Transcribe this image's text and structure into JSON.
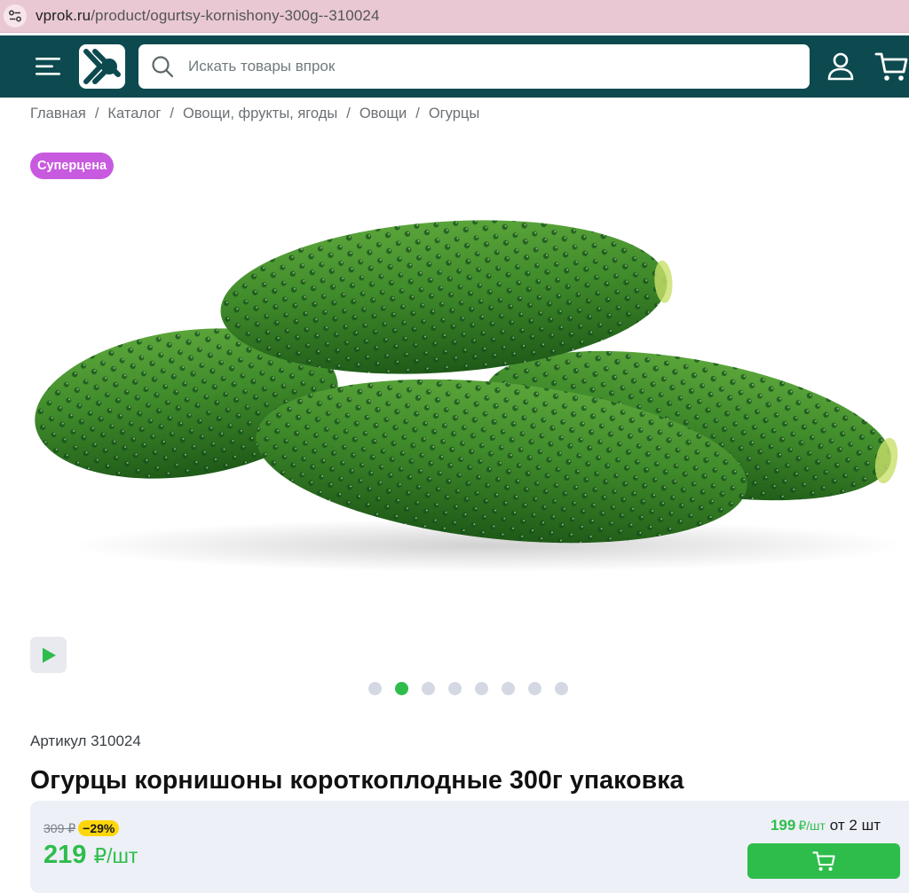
{
  "browser": {
    "url_host": "vprok.ru",
    "url_path": "/product/ogurtsy-kornishony-300g--310024",
    "site_info_icon": "tune-icon"
  },
  "header": {
    "search_placeholder": "Искать товары впрок",
    "icons": {
      "menu": "hamburger-menu-icon",
      "logo": "vprok-logo",
      "search": "search-icon",
      "profile": "user-icon",
      "cart": "cart-icon"
    },
    "colors": {
      "background": "#0d4a4f"
    }
  },
  "breadcrumb": [
    "Главная",
    "Каталог",
    "Овощи, фрукты, ягоды",
    "Овощи",
    "Огурцы"
  ],
  "breadcrumb_separator": "/",
  "badge": {
    "label": "Суперцена",
    "color": "#c85ae0"
  },
  "gallery": {
    "image_subject": "cucumbers",
    "slide_count": 8,
    "active_slide_index": 1,
    "play_icon": "play-icon"
  },
  "product": {
    "sku_label": "Артикул 310024",
    "title": "Огурцы корнишоны короткоплодные 300г упаковка"
  },
  "pricing": {
    "old_price": "309 ₽",
    "discount": "−29%",
    "price_value": "219",
    "price_unit": "₽/шт",
    "bulk_price": "199",
    "bulk_unit": "₽/шт",
    "bulk_condition": "от 2 шт",
    "accent_color": "#2ebd4b",
    "discount_color": "#ffd60a"
  },
  "add_to_cart_icon": "cart-icon"
}
